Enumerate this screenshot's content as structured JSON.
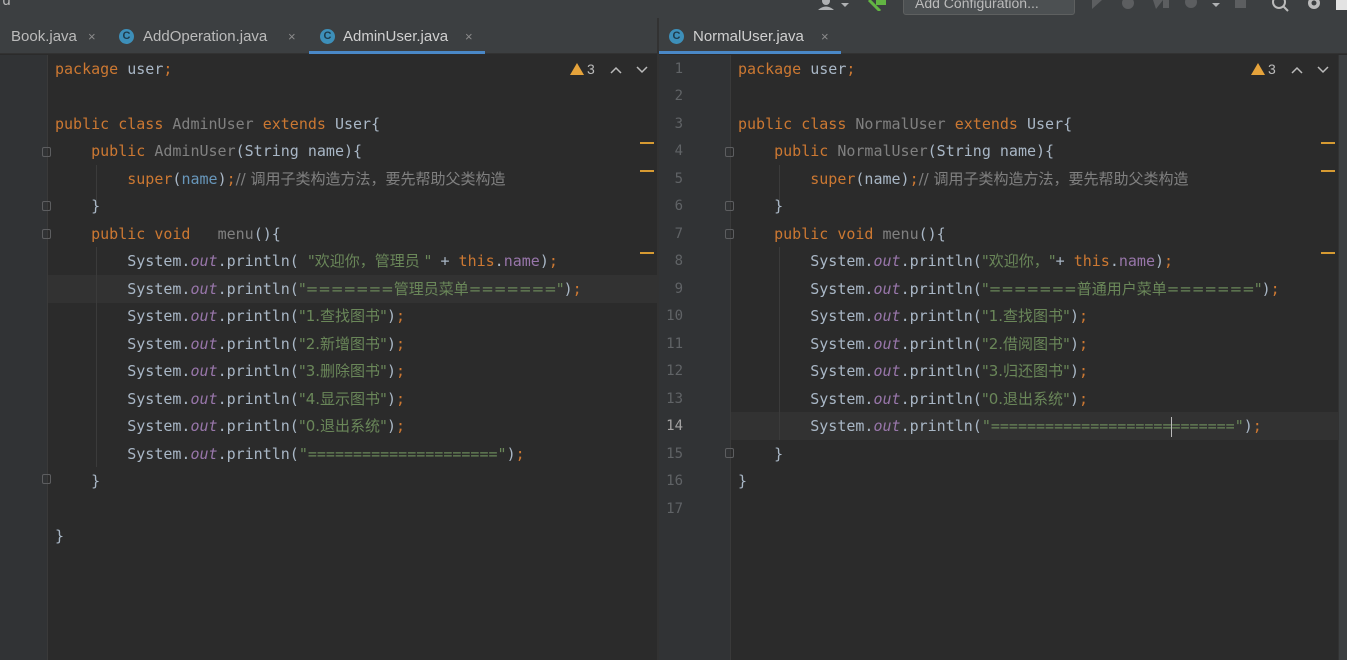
{
  "toolbar": {
    "title_fragment": "u",
    "run_config": "Add Configuration..."
  },
  "left_editor": {
    "tabs": [
      {
        "label": "Book.java",
        "close": "×",
        "icon": "class-icon"
      },
      {
        "label": "AddOperation.java",
        "close": "×",
        "icon": "class-icon"
      },
      {
        "label": "AdminUser.java",
        "close": "×",
        "icon": "class-icon",
        "active": true
      }
    ],
    "inspection": {
      "warnings": "3",
      "icon": "warning-icon"
    },
    "code": {
      "l1": {
        "kw": "package",
        "text": " user",
        "semi": ";"
      },
      "l3": {
        "kw1": "public",
        "kw2": "class",
        "name": "AdminUser",
        "kw3": "extends",
        "rest": " User{"
      },
      "l4": {
        "kw": "public",
        "name": "AdminUser",
        "rest": "(String name){"
      },
      "l5": {
        "kw": "super",
        "p1": "(",
        "field": "name",
        "p2": ")",
        "semi": ";",
        "comment": "// 调用子类构造方法，要先帮助父类构造"
      },
      "l6": {
        "text": "}"
      },
      "l7": {
        "kw1": "public",
        "kw2": "void",
        "name": "menu",
        "rest": "(){"
      },
      "l8": {
        "pre": "System.",
        "out": "out",
        "mid": ".println( ",
        "str": "\"欢迎你，管理员 \"",
        "plus": " + ",
        "kw": "this",
        "dot": ".",
        "field": "name",
        "end": ")",
        "semi": ";"
      },
      "l9": {
        "pre": "System.",
        "out": "out",
        "mid": ".println(",
        "str": "\"=======管理员菜单=======\"",
        "end": ")",
        "semi": ";"
      },
      "l10": {
        "pre": "System.",
        "out": "out",
        "mid": ".println(",
        "str": "\"1.查找图书\"",
        "end": ")",
        "semi": ";"
      },
      "l11": {
        "pre": "System.",
        "out": "out",
        "mid": ".println(",
        "str": "\"2.新增图书\"",
        "end": ")",
        "semi": ";"
      },
      "l12": {
        "pre": "System.",
        "out": "out",
        "mid": ".println(",
        "str": "\"3.删除图书\"",
        "end": ")",
        "semi": ";"
      },
      "l13": {
        "pre": "System.",
        "out": "out",
        "mid": ".println(",
        "str": "\"4.显示图书\"",
        "end": ")",
        "semi": ";"
      },
      "l14": {
        "pre": "System.",
        "out": "out",
        "mid": ".println(",
        "str": "\"0.退出系统\"",
        "end": ")",
        "semi": ";"
      },
      "l15": {
        "pre": "System.",
        "out": "out",
        "mid": ".println(",
        "str": "\"=====================\"",
        "end": ")",
        "semi": ";"
      },
      "l16": {
        "text": "}"
      },
      "l18": {
        "text": "}"
      }
    }
  },
  "right_editor": {
    "tabs": [
      {
        "label": "NormalUser.java",
        "close": "×",
        "icon": "class-icon",
        "active": true
      }
    ],
    "inspection": {
      "warnings": "3",
      "icon": "warning-icon"
    },
    "line_numbers": [
      "1",
      "2",
      "3",
      "4",
      "5",
      "6",
      "7",
      "8",
      "9",
      "10",
      "11",
      "12",
      "13",
      "14",
      "15",
      "16",
      "17"
    ],
    "current_line": "14",
    "code": {
      "l1": {
        "kw": "package",
        "text": " user",
        "semi": ";"
      },
      "l3": {
        "kw1": "public",
        "kw2": "class",
        "name": "NormalUser",
        "kw3": "extends",
        "rest": " User{"
      },
      "l4": {
        "kw": "public",
        "name": "NormalUser",
        "rest": "(String name){"
      },
      "l5": {
        "kw": "super",
        "p1": "(name)",
        "semi": ";",
        "comment": "// 调用子类构造方法，要先帮助父类构造"
      },
      "l6": {
        "text": "}"
      },
      "l7": {
        "kw1": "public",
        "kw2": "void",
        "name": "menu",
        "rest": "(){"
      },
      "l8": {
        "pre": "System.",
        "out": "out",
        "mid": ".println(",
        "str": "\"欢迎你，\"",
        "plus": "+ ",
        "kw": "this",
        "dot": ".",
        "field": "name",
        "end": ")",
        "semi": ";"
      },
      "l9": {
        "pre": "System.",
        "out": "out",
        "mid": ".println(",
        "str": "\"=======普通用户菜单=======\"",
        "end": ")",
        "semi": ";"
      },
      "l10": {
        "pre": "System.",
        "out": "out",
        "mid": ".println(",
        "str": "\"1.查找图书\"",
        "end": ")",
        "semi": ";"
      },
      "l11": {
        "pre": "System.",
        "out": "out",
        "mid": ".println(",
        "str": "\"2.借阅图书\"",
        "end": ")",
        "semi": ";"
      },
      "l12": {
        "pre": "System.",
        "out": "out",
        "mid": ".println(",
        "str": "\"3.归还图书\"",
        "end": ")",
        "semi": ";"
      },
      "l13": {
        "pre": "System.",
        "out": "out",
        "mid": ".println(",
        "str": "\"0.退出系统\"",
        "end": ")",
        "semi": ";"
      },
      "l14": {
        "pre": "System.",
        "out": "out",
        "mid": ".println(",
        "str_a": "\"====================",
        "str_b": "=======\"",
        "end": ")",
        "semi": ";"
      },
      "l15": {
        "text": "}"
      },
      "l16": {
        "text": "}"
      }
    }
  }
}
